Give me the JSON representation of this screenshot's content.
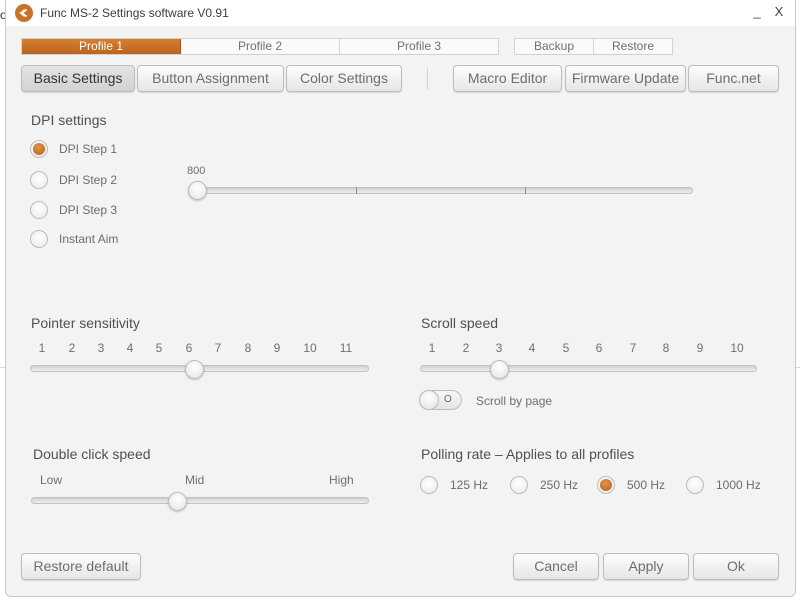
{
  "window": {
    "title": "Func MS-2 Settings software V0.91",
    "minimize_label": "_",
    "close_label": "X"
  },
  "background": {
    "left_glyph": "o"
  },
  "profiles": {
    "tabs": [
      {
        "label": "Profile 1",
        "active": true
      },
      {
        "label": "Profile 2",
        "active": false
      },
      {
        "label": "Profile 3",
        "active": false
      }
    ],
    "backup_label": "Backup",
    "restore_label": "Restore"
  },
  "nav": {
    "basic_settings": "Basic Settings",
    "button_assignment": "Button Assignment",
    "color_settings": "Color Settings",
    "macro_editor": "Macro Editor",
    "firmware_update": "Firmware Update",
    "func_net": "Func.net",
    "active_tab": "basic_settings"
  },
  "dpi": {
    "title": "DPI settings",
    "steps": [
      {
        "label": "DPI Step 1",
        "selected": true
      },
      {
        "label": "DPI Step 2",
        "selected": false
      },
      {
        "label": "DPI Step 3",
        "selected": false
      },
      {
        "label": "Instant Aim",
        "selected": false
      }
    ],
    "value_label": "800",
    "slider_value": 0
  },
  "pointer": {
    "title": "Pointer sensitivity",
    "scale": [
      "1",
      "2",
      "3",
      "4",
      "5",
      "6",
      "7",
      "8",
      "9",
      "10",
      "11"
    ],
    "value": 6
  },
  "scroll": {
    "title": "Scroll speed",
    "scale": [
      "1",
      "2",
      "3",
      "4",
      "5",
      "6",
      "7",
      "8",
      "9",
      "10"
    ],
    "value": 3,
    "by_page_label": "Scroll by page",
    "by_page_toggle_state": "O"
  },
  "double_click": {
    "title": "Double click speed",
    "low": "Low",
    "mid": "Mid",
    "high": "High",
    "value": "Mid"
  },
  "polling": {
    "title": "Polling rate – Applies to all profiles",
    "options": [
      {
        "label": "125 Hz",
        "selected": false
      },
      {
        "label": "250 Hz",
        "selected": false
      },
      {
        "label": "500 Hz",
        "selected": true
      },
      {
        "label": "1000 Hz",
        "selected": false
      }
    ]
  },
  "footer": {
    "restore_default": "Restore default",
    "cancel": "Cancel",
    "apply": "Apply",
    "ok": "Ok"
  },
  "colors": {
    "accent": "#c8732b",
    "window_bg": "#f3f3f3"
  }
}
